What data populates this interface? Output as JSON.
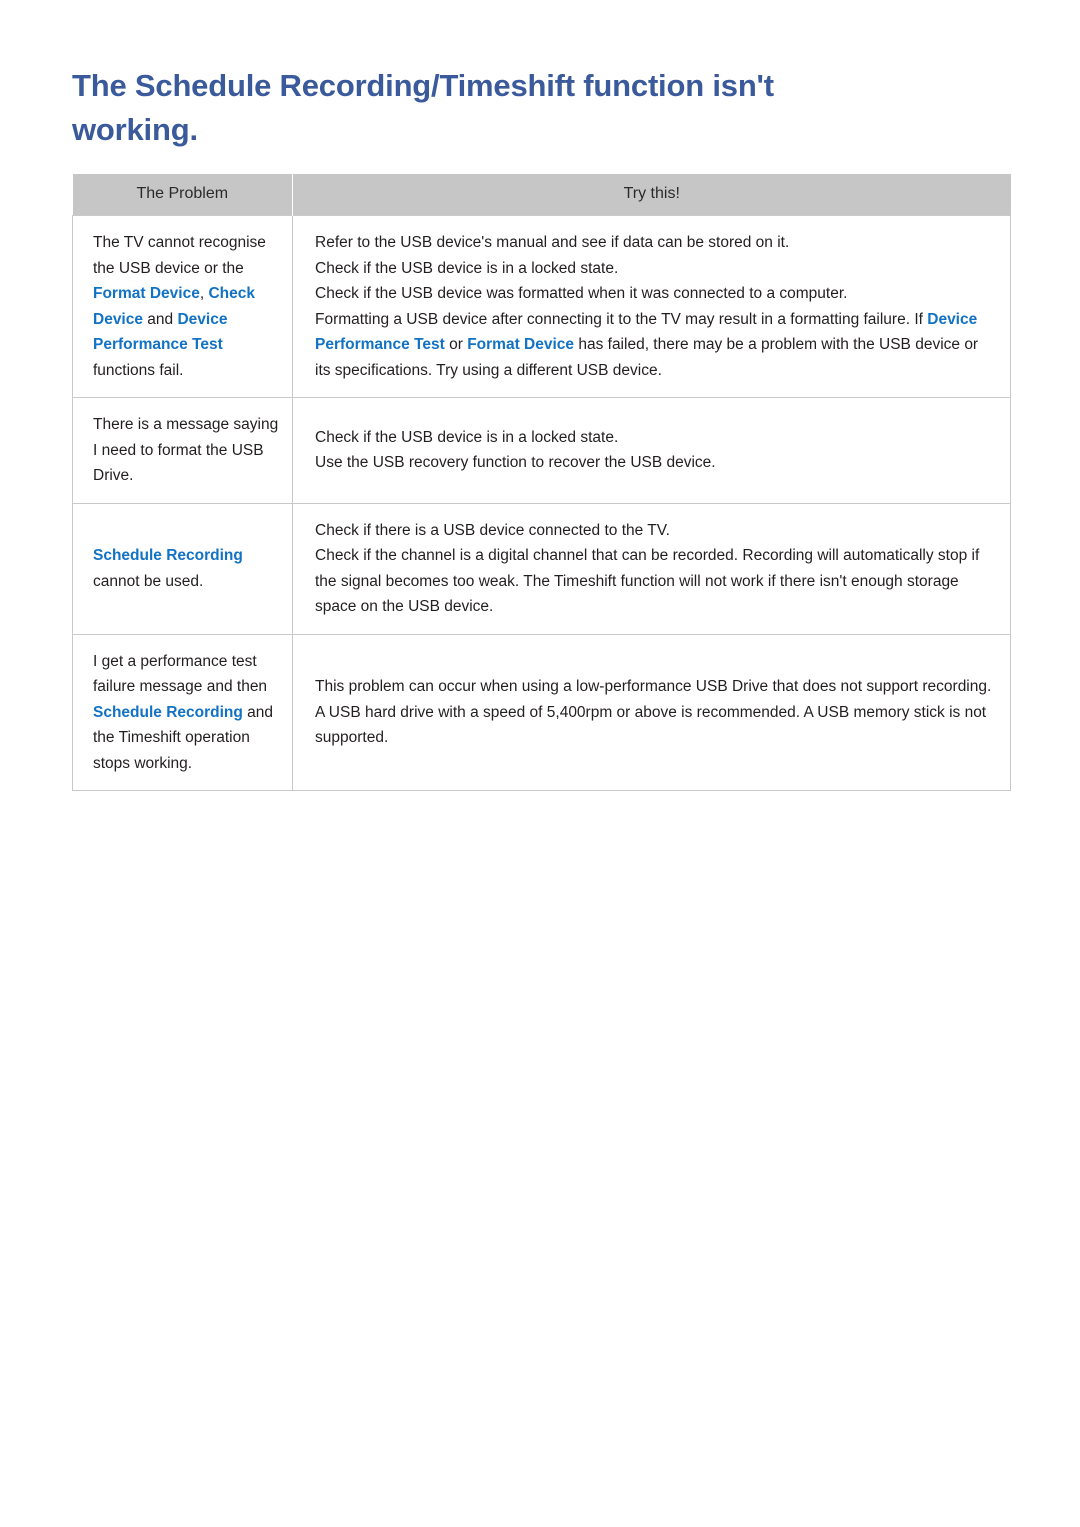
{
  "document": {
    "title": "The Schedule Recording/Timeshift function isn't working."
  },
  "colors": {
    "title_blue": "#3a5a9b",
    "highlight_blue": "#1272c4",
    "header_grey": "#c6c6c6",
    "border_grey": "#c9c9c9",
    "body_text": "#231f20"
  },
  "table": {
    "headers": {
      "problem": "The Problem",
      "try_this": "Try this!"
    },
    "rows": [
      {
        "problem_segments": [
          {
            "text": "The TV cannot recognise the USB device or the ",
            "highlight": false
          },
          {
            "text": "Format Device",
            "highlight": true
          },
          {
            "text": ", ",
            "highlight": false
          },
          {
            "text": "Check Device",
            "highlight": true
          },
          {
            "text": " and ",
            "highlight": false
          },
          {
            "text": "Device Performance Test",
            "highlight": true
          },
          {
            "text": " functions fail.",
            "highlight": false
          }
        ],
        "try_lines": [
          [
            {
              "text": "Refer to the USB device's manual and see if data can be stored on it.",
              "highlight": false
            }
          ],
          [
            {
              "text": "Check if the USB device is in a locked state.",
              "highlight": false
            }
          ],
          [
            {
              "text": "Check if the USB device was formatted when it was connected to a computer.",
              "highlight": false
            }
          ],
          [
            {
              "text": "Formatting a USB device after connecting it to the TV may result in a formatting failure. If ",
              "highlight": false
            },
            {
              "text": "Device Performance Test",
              "highlight": true
            },
            {
              "text": " or ",
              "highlight": false
            },
            {
              "text": "Format Device",
              "highlight": true
            },
            {
              "text": " has failed, there may be a problem with the USB device or its specifications. Try using a different USB device.",
              "highlight": false
            }
          ]
        ]
      },
      {
        "problem_segments": [
          {
            "text": "There is a message saying I need to format the USB Drive.",
            "highlight": false
          }
        ],
        "try_lines": [
          [
            {
              "text": "Check if the USB device is in a locked state.",
              "highlight": false
            }
          ],
          [
            {
              "text": "Use the USB recovery function to recover the USB device.",
              "highlight": false
            }
          ]
        ]
      },
      {
        "problem_segments": [
          {
            "text": "Schedule Recording",
            "highlight": true
          },
          {
            "text": " cannot be used.",
            "highlight": false
          }
        ],
        "try_lines": [
          [
            {
              "text": "Check if there is a USB device connected to the TV.",
              "highlight": false
            }
          ],
          [
            {
              "text": "Check if the channel is a digital channel that can be recorded. Recording will automatically stop if the signal becomes too weak. The Timeshift function will not work if there isn't enough storage space on the USB device.",
              "highlight": false
            }
          ]
        ]
      },
      {
        "problem_segments": [
          {
            "text": "I get a performance test failure message and then ",
            "highlight": false
          },
          {
            "text": "Schedule Recording",
            "highlight": true
          },
          {
            "text": " and the Timeshift operation stops working.",
            "highlight": false
          }
        ],
        "try_lines": [
          [
            {
              "text": "This problem can occur when using a low-performance USB Drive that does not support recording. A USB hard drive with a speed of 5,400rpm or above is recommended. A USB memory stick is not supported.",
              "highlight": false
            }
          ]
        ]
      }
    ]
  }
}
